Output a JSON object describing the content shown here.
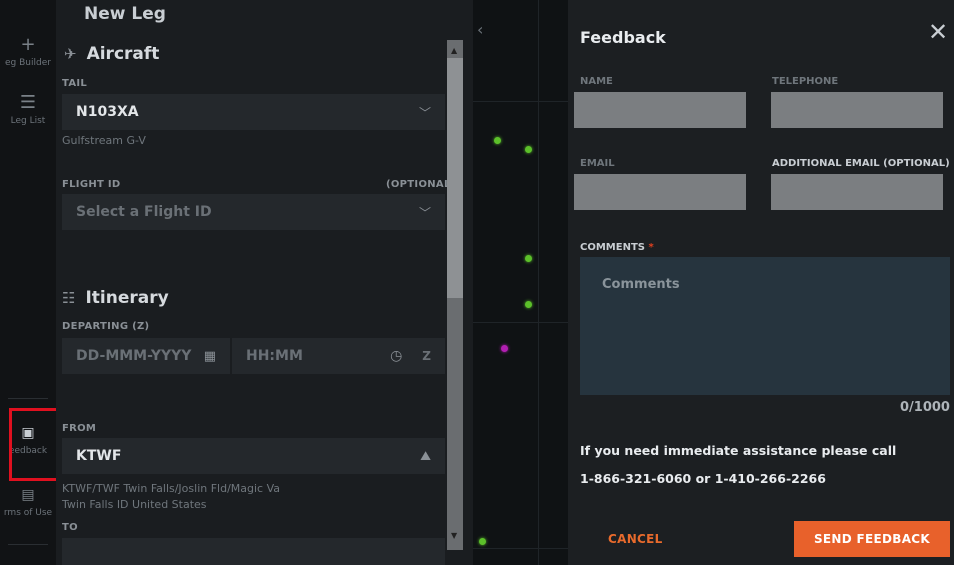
{
  "nav": {
    "items": [
      {
        "icon": "plus-icon",
        "label": "eg Builder"
      },
      {
        "icon": "list-icon",
        "label": "Leg List"
      },
      {
        "icon": "feedback-icon",
        "label": "eedback"
      },
      {
        "icon": "document-icon",
        "label": "rms of Use"
      }
    ]
  },
  "leg": {
    "title": "New Leg",
    "aircraft_section": "Aircraft",
    "tail_label": "TAIL",
    "tail_value": "N103XA",
    "aircraft_type": "Gulfstream G-V",
    "flight_id_label": "FLIGHT ID",
    "flight_id_optional": "(OPTIONAL)",
    "flight_id_placeholder": "Select a Flight ID",
    "itinerary_section": "Itinerary",
    "departing_label": "DEPARTING (Z)",
    "date_placeholder": "DD-MMM-YYYY",
    "time_placeholder": "HH:MM",
    "tz": "Z",
    "from_label": "FROM",
    "from_value": "KTWF",
    "from_desc_1": "KTWF/TWF Twin Falls/Joslin Fld/Magic Va",
    "from_desc_2": "Twin Falls ID United States",
    "to_label": "TO"
  },
  "feedback": {
    "title": "Feedback",
    "name_label": "NAME",
    "telephone_label": "TELEPHONE",
    "email_label": "EMAIL",
    "additional_email_label": "ADDITIONAL EMAIL (OPTIONAL)",
    "comments_label": "COMMENTS",
    "required_mark": "*",
    "comments_placeholder": "Comments",
    "counter": "0/1000",
    "assist_text": "If you need immediate assistance please call",
    "phones": "1-866-321-6060 or 1-410-266-2266",
    "cancel_label": "CANCEL",
    "send_label": "SEND FEEDBACK"
  },
  "colors": {
    "accent": "#e8612b",
    "highlight": "#e0101f",
    "map_dot": "#5cc02a",
    "map_dot_alt": "#b21fb2"
  }
}
